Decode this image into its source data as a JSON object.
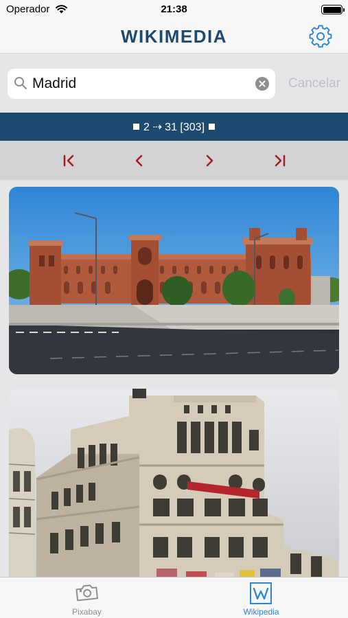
{
  "status_bar": {
    "carrier": "Operador",
    "time": "21:38"
  },
  "nav": {
    "title": "WIKIMEDIA",
    "settings_icon": "gear-icon"
  },
  "search": {
    "value": "Madrid",
    "placeholder": "",
    "cancel_label": "Cancelar"
  },
  "page_info": {
    "text": "2 ⇢ 31  [303]"
  },
  "pager": {
    "buttons": [
      "first-page-icon",
      "previous-page-icon",
      "next-page-icon",
      "last-page-icon"
    ],
    "color": "#a31d1d"
  },
  "results": [
    {
      "kind": "photo",
      "subject": "bullring-plaza"
    },
    {
      "kind": "photo",
      "subject": "corner-building"
    }
  ],
  "tabs": [
    {
      "label": "Pixabay",
      "icon": "camera-icon",
      "selected": false
    },
    {
      "label": "Wikipedia",
      "icon": "wikipedia-icon",
      "selected": true
    }
  ],
  "colors": {
    "brand": "#1d4a6e",
    "accent": "#2a86d8",
    "pager": "#a31d1d"
  }
}
